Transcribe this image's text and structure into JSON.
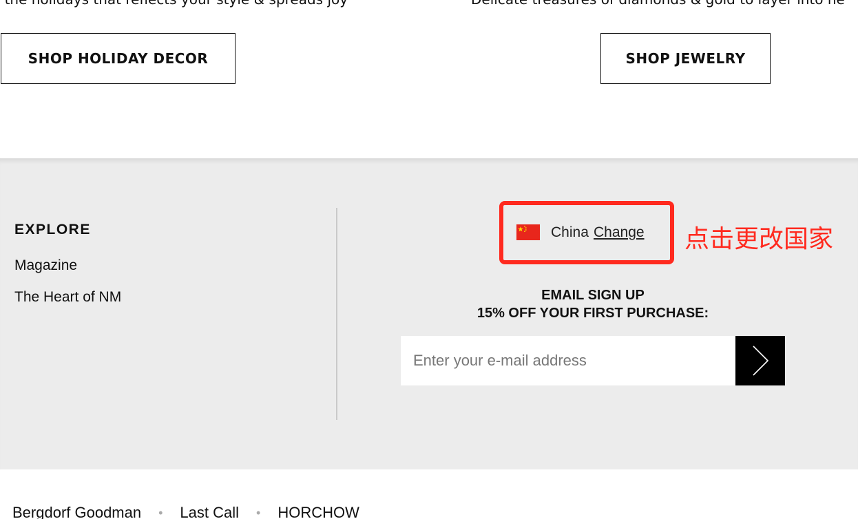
{
  "promo": {
    "left_text": "r the holidays that reflects your style & spreads joy",
    "right_text": "Delicate treasures of diamonds & gold to layer into he",
    "left_button": "SHOP HOLIDAY DECOR",
    "right_button": "SHOP JEWELRY"
  },
  "footer": {
    "explore": {
      "heading": "EXPLORE",
      "links": [
        "Magazine",
        "The Heart of NM"
      ]
    },
    "country": {
      "flag_icon": "china-flag-icon",
      "name": "China",
      "change_label": "Change",
      "annotation": "点击更改国家",
      "highlight_color": "#ff2a1f"
    },
    "signup": {
      "title_line_1": "EMAIL SIGN UP",
      "title_line_2": "15% OFF YOUR FIRST PURCHASE:",
      "placeholder": "Enter your e-mail address",
      "submit_icon": "chevron-right-icon"
    },
    "background_color": "#ececec"
  },
  "brands": {
    "links": [
      "Bergdorf Goodman",
      "Last Call",
      "HORCHOW"
    ],
    "separator": "•"
  }
}
